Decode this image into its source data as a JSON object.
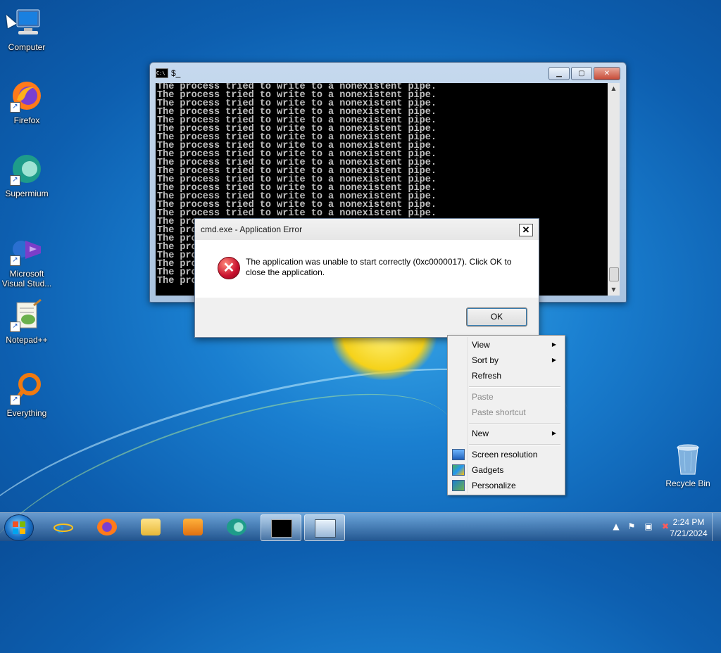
{
  "desktop": {
    "icons": [
      {
        "label": "Computer",
        "icon": "computer-icon"
      },
      {
        "label": "Firefox",
        "icon": "firefox-icon"
      },
      {
        "label": "Supermium",
        "icon": "supermium-icon"
      },
      {
        "label": "Microsoft Visual Stud...",
        "icon": "visual-studio-icon"
      },
      {
        "label": "Notepad++",
        "icon": "notepadpp-icon"
      },
      {
        "label": "Everything",
        "icon": "everything-icon"
      }
    ],
    "recycle_bin": "Recycle Bin"
  },
  "cmd_window": {
    "title": "$_",
    "console_line": "The process tried to write to a nonexistent pipe.",
    "truncated_line": "The pro",
    "minimize": "▁",
    "maximize": "▢",
    "close": "✕"
  },
  "error_dialog": {
    "title": "cmd.exe - Application Error",
    "message": "The application was unable to start correctly (0xc0000017). Click OK to close the application.",
    "ok_label": "OK",
    "close_label": "✕"
  },
  "context_menu": {
    "items": [
      {
        "label": "View",
        "submenu": true,
        "disabled": false
      },
      {
        "label": "Sort by",
        "submenu": true,
        "disabled": false
      },
      {
        "label": "Refresh",
        "submenu": false,
        "disabled": false
      },
      {
        "label": "Paste",
        "submenu": false,
        "disabled": true
      },
      {
        "label": "Paste shortcut",
        "submenu": false,
        "disabled": true
      },
      {
        "label": "New",
        "submenu": true,
        "disabled": false
      },
      {
        "label": "Screen resolution",
        "submenu": false,
        "disabled": false,
        "icon": "screen-resolution-icon"
      },
      {
        "label": "Gadgets",
        "submenu": false,
        "disabled": false,
        "icon": "gadgets-icon"
      },
      {
        "label": "Personalize",
        "submenu": false,
        "disabled": false,
        "icon": "personalize-icon"
      }
    ]
  },
  "taskbar": {
    "apps": [
      "internet-explorer-icon",
      "firefox-icon",
      "file-explorer-icon",
      "media-player-icon",
      "supermium-icon",
      "cmd-icon",
      "app-window-icon"
    ],
    "time": "2:24 PM",
    "date": "7/21/2024"
  }
}
